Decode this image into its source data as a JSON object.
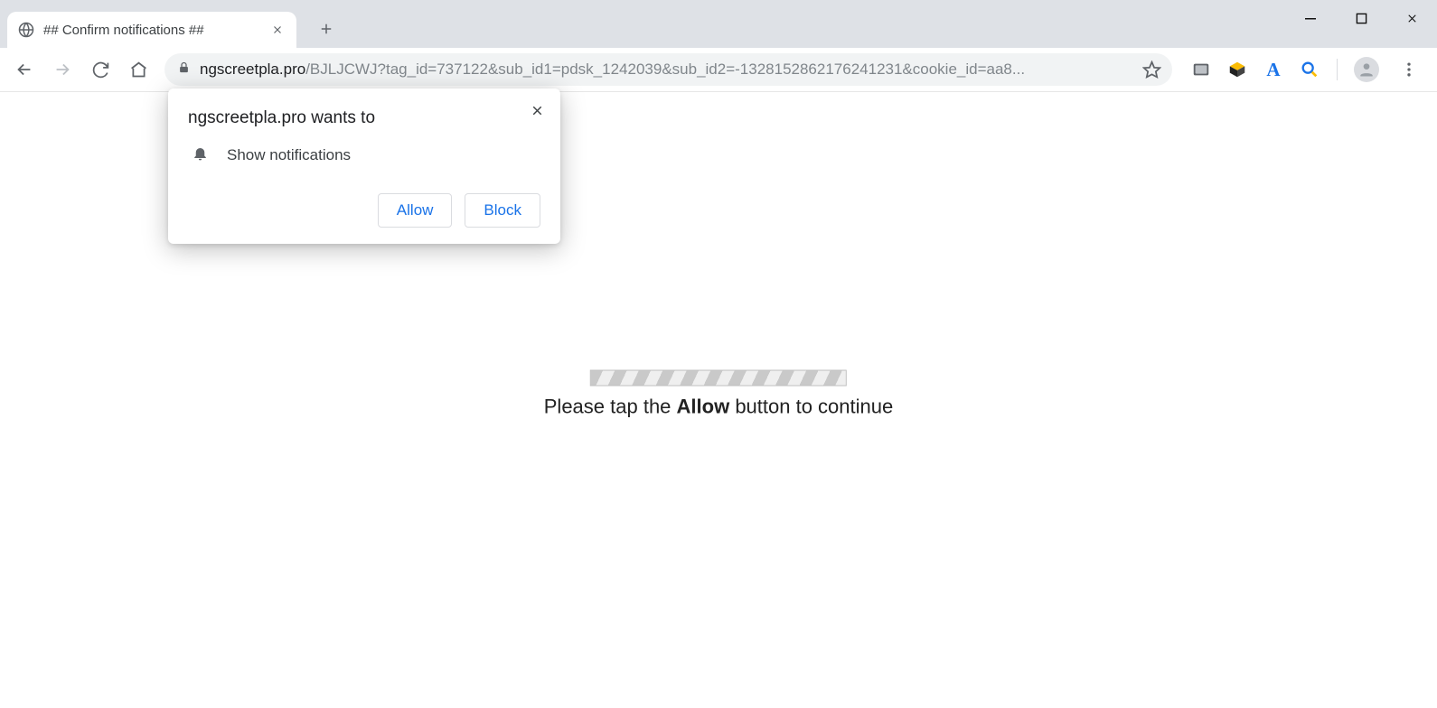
{
  "tab": {
    "title": "## Confirm notifications ##"
  },
  "url": {
    "domain": "ngscreetpla.pro",
    "path": "/BJLJCWJ?tag_id=737122&sub_id1=pdsk_1242039&sub_id2=-1328152862176241231&cookie_id=aa8..."
  },
  "popup": {
    "title": "ngscreetpla.pro wants to",
    "permission_label": "Show notifications",
    "allow_label": "Allow",
    "block_label": "Block"
  },
  "page": {
    "msg_pre": "Please tap the ",
    "msg_bold": "Allow",
    "msg_post": " button to continue"
  }
}
